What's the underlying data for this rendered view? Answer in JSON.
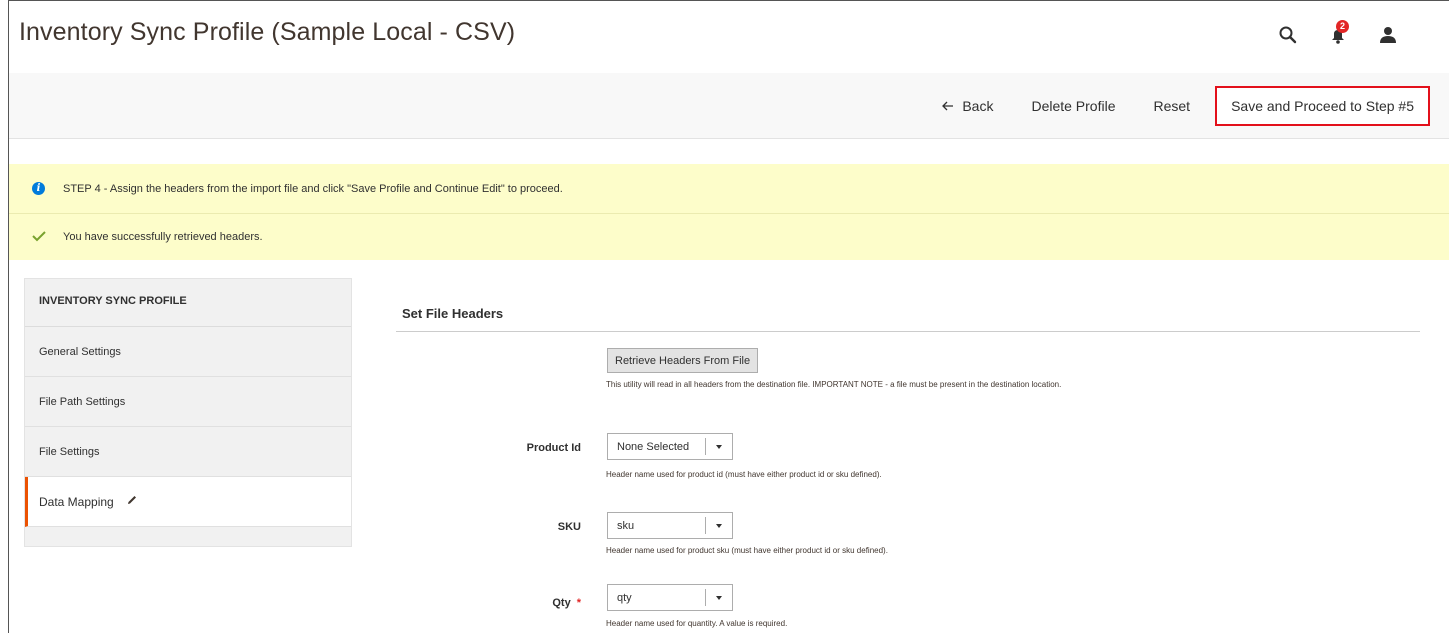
{
  "header": {
    "title": "Inventory Sync Profile (Sample Local - CSV)",
    "notification_count": "2"
  },
  "actions": {
    "back": "Back",
    "delete": "Delete Profile",
    "reset": "Reset",
    "save_proceed": "Save and Proceed to Step #5"
  },
  "messages": {
    "info": "STEP 4 - Assign the headers from the import file and click \"Save Profile and Continue Edit\" to proceed.",
    "success": "You have successfully retrieved headers."
  },
  "sidebar": {
    "title": "INVENTORY SYNC PROFILE",
    "items": [
      {
        "label": "General Settings"
      },
      {
        "label": "File Path Settings"
      },
      {
        "label": "File Settings"
      },
      {
        "label": "Data Mapping"
      }
    ]
  },
  "section": {
    "title": "Set File Headers",
    "retrieve_button": "Retrieve Headers From File",
    "retrieve_note": "This utility will read in all headers from the destination file. IMPORTANT NOTE - a file must be present in the destination location.",
    "fields": [
      {
        "label": "Product Id",
        "value": "None Selected",
        "note": "Header name used for product id (must have either product id or sku defined).",
        "required": false
      },
      {
        "label": "SKU",
        "value": "sku",
        "note": "Header name used for product sku (must have either product id or sku defined).",
        "required": false
      },
      {
        "label": "Qty",
        "value": "qty",
        "note": "Header name used for quantity. A value is required.",
        "required": true,
        "required_mark": "*"
      }
    ]
  },
  "colors": {
    "accent": "#eb5202",
    "highlight_border": "#e3101b",
    "message_bg": "#fdfdca",
    "info": "#007bdb",
    "success": "#79a22e"
  },
  "icons": [
    "search-icon",
    "bell-icon",
    "user-icon",
    "arrow-left-icon",
    "info-icon",
    "checkmark-icon",
    "pencil-icon",
    "chevron-down-icon"
  ]
}
